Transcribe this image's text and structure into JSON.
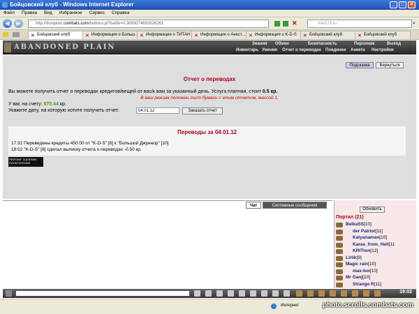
{
  "window": {
    "title": "Бойцовский клуб - Windows Internet Explorer",
    "minimize": "_",
    "maximize": "□",
    "close": "✕"
  },
  "menu": [
    "Файл",
    "Правка",
    "Вид",
    "Избранное",
    "Сервис",
    "Справка"
  ],
  "address": {
    "prefix": "http://dungeon.",
    "domain": "combats.com",
    "suffix": "/buttons.pl?battle=0.3693074692626261"
  },
  "search": {
    "placeholder": "Inet123.ru"
  },
  "tabs": [
    "Бойцовский клуб",
    "Информация о Больш...",
    "Информация о ТИТАН",
    "Информация о Анест...",
    "Информация о K-D-S",
    "Бойцовский клуб",
    "Бойцовский клуб"
  ],
  "game": {
    "logo": "ABANDONED PLAIN",
    "nav_top": [
      "Знания",
      "Обмен",
      "Безопасность",
      "Персонаж",
      "Выход"
    ],
    "nav_bottom": [
      "Инвентарь",
      "Умения",
      "Отчет о переводах",
      "Поединки",
      "Анкета",
      "Настройки"
    ]
  },
  "report": {
    "hint_button": "Подсказка",
    "back_button": "Вернуться",
    "title": "Отчет о переводах",
    "desc_text": "Вы можете получить отчет о переводах кредитов/вещей от вас/к вам за указанный день. Услуга платная, стоит",
    "desc_price": "0.5 кр.",
    "notice": "В ваш рюкзак положен лист бумаги с этим отчетом, массой 1.",
    "balance_label": "У вас на счету:",
    "balance_value": "970.44",
    "balance_unit": "кр.",
    "date_label": "Укажите дату, на которую хотите получить отчет:",
    "date_value": "04.01.12",
    "order_button": "Заказать отчет"
  },
  "transfers": {
    "title": "Переводы за 04.01.12",
    "lines": [
      "17:32 Переведены кредиты 450.00 от \"K-D-S\" [8] к \"Большой Джуннор\" [10]",
      "19:02 \"K-D-S\" [8] сделал выписку отчета о переводах -0.50 кр."
    ]
  },
  "counter_text": "РЕЙТИНГ 118749090 ПОСЕТИТЕЛЕЙ",
  "chat": {
    "tab_chat": "Чат",
    "tab_system": "Системные сообщения"
  },
  "users": {
    "refresh_button": "Обновить",
    "room": "Портал (21)",
    "list": [
      {
        "name": "BelkaSS",
        "level": "[10]"
      },
      {
        "name": "der Patriot",
        "level": "[11]"
      },
      {
        "name": "Kalyanaman",
        "level": "[10]"
      },
      {
        "name": "Karas_from_Hell",
        "level": "[11"
      },
      {
        "name": "KRITton",
        "level": "[12]"
      },
      {
        "name": "Lirlik",
        "level": "[9]"
      },
      {
        "name": "Magic rain",
        "level": "[10]"
      },
      {
        "name": "max-boi",
        "level": "[10]"
      },
      {
        "name": "Mr Ganj",
        "level": "[10]"
      },
      {
        "name": "Strange R",
        "level": "[11]"
      }
    ]
  },
  "clock": "19:02",
  "status": {
    "zone": "Интернет"
  },
  "watermark": "photo.scrolls.combats.com"
}
